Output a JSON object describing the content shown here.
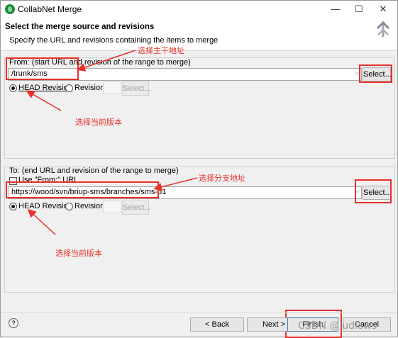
{
  "window": {
    "title": "CollabNet Merge",
    "minimize": "—",
    "maximize": "☐",
    "close": "✕"
  },
  "header": {
    "title": "Select the merge source and revisions",
    "subtitle": "Specify the URL and revisions containing the items to merge"
  },
  "from": {
    "group_label": "From: (start URL and revision of the range to merge)",
    "url": "/trunk/sms",
    "select_label": "Select...",
    "head_label": "HEAD Revision",
    "revision_label": "Revision",
    "rev_select_label": "Select..."
  },
  "to": {
    "group_label": "To: (end URL and revision of the range to merge)",
    "use_from_label": "Use \"From:\" URL",
    "url": "https://wood/svn/briup-sms/branches/sms-b1",
    "select_label": "Select...",
    "head_label": "HEAD Revision",
    "revision_label": "Revision",
    "rev_select_label": "Select..."
  },
  "annotations": {
    "from_addr": "选择主干地址",
    "from_rev": "选择当前版本",
    "to_addr": "选择分支地址",
    "to_rev": "选择当前版本"
  },
  "footer": {
    "help": "?",
    "back": "< Back",
    "next": "Next >",
    "finish": "Finish",
    "cancel": "Cancel"
  },
  "watermark": "CSDN @ludlows",
  "colors": {
    "annotation": "#e8302a",
    "title_icon": "#1e8a3c"
  }
}
